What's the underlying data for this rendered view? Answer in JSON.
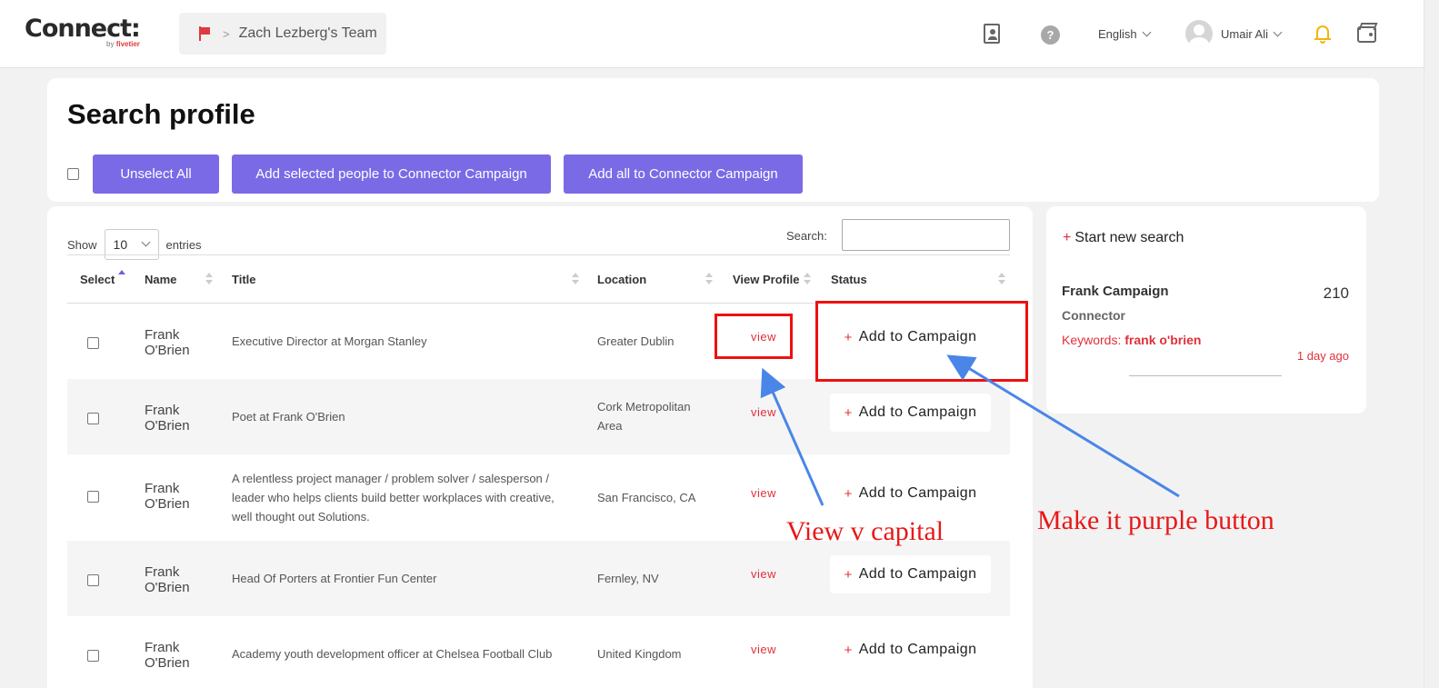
{
  "header": {
    "logo": "Connect:",
    "logo_sub_by": "by",
    "logo_sub_brand": "fivetier",
    "team_sep": ">",
    "team": "Zach Lezberg's Team",
    "language": "English",
    "user": "Umair Ali",
    "help_glyph": "?",
    "icons": [
      "contacts-book-icon",
      "help-icon",
      "bell-icon",
      "wallet-icon"
    ]
  },
  "page": {
    "title": "Search profile",
    "buttons": {
      "unselect_all": "Unselect All",
      "add_selected": "Add selected people to Connector Campaign",
      "add_all": "Add all to Connector Campaign"
    }
  },
  "table": {
    "show_label": "Show",
    "entries_value": "10",
    "entries_label": "entries",
    "search_label": "Search:",
    "columns": [
      "Select",
      "Name",
      "Title",
      "Location",
      "View Profile",
      "Status"
    ],
    "view_label": "view",
    "add_label": "Add to Campaign",
    "add_plus": "+",
    "rows": [
      {
        "name": "Frank O'Brien",
        "title": "Executive Director at Morgan Stanley",
        "location": "Greater Dublin"
      },
      {
        "name": "Frank O'Brien",
        "title": "Poet at Frank O'Brien",
        "location": "Cork Metropolitan Area"
      },
      {
        "name": "Frank O'Brien",
        "title": "A relentless project manager / problem solver / salesperson / leader who helps clients build better workplaces with creative, well thought out Solutions.",
        "location": "San Francisco, CA"
      },
      {
        "name": "Frank O'Brien",
        "title": "Head Of Porters at Frontier Fun Center",
        "location": "Fernley, NV"
      },
      {
        "name": "Frank O'Brien",
        "title": "Academy youth development officer at Chelsea Football Club",
        "location": "United Kingdom"
      }
    ]
  },
  "sidebar": {
    "start_plus": "+",
    "start_new_search": "Start new search",
    "campaign": {
      "name": "Frank Campaign",
      "count": "210",
      "type": "Connector",
      "keywords_label": "Keywords:",
      "keywords": "frank o'brien",
      "time": "1 day ago"
    }
  },
  "annotations": {
    "view_note": "View v capital",
    "button_note": "Make it purple button",
    "color": "#e81818",
    "arrow_color": "#4a86e8"
  },
  "colors": {
    "accent_purple": "#7b6ae6",
    "accent_red": "#e0303a",
    "bell": "#f2b50b"
  }
}
